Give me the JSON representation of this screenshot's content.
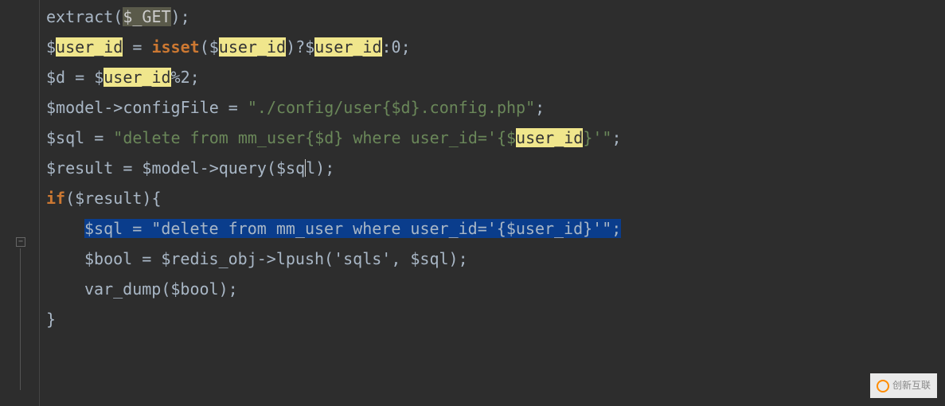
{
  "code": {
    "line1": {
      "t1": "extract(",
      "t2": "$_GET",
      "t3": ");"
    },
    "line2": {
      "t1": "$",
      "t2": "user_id",
      "t3": " = ",
      "t4": "isset",
      "t5": "($",
      "t6": "user_id",
      "t7": ")?$",
      "t8": "user_id",
      "t9": ":0;"
    },
    "line3": {
      "t1": "$d = $",
      "t2": "user_id",
      "t3": "%2;"
    },
    "line4": {
      "t1": "$model->configFile = ",
      "t2": "\"./config/user{$d}.config.php\"",
      "t3": ";"
    },
    "line5": {
      "t1": "$sql = ",
      "t2": "\"delete from mm_user{$d} where user_id='{$",
      "t3": "user_id",
      "t4": "}'\"",
      "t5": ";"
    },
    "line6": {
      "t1": "$result = $model->query($sq",
      "t2": "l);"
    },
    "line7": {
      "t1": "if",
      "t2": "($result){"
    },
    "line8": {
      "t1": "$sql = ",
      "t2": "\"delete from mm_user where user_id='{$user_id}'\"",
      "t3": ";"
    },
    "line9": {
      "t1": "$bool = $redis_obj->lpush('sqls', $sql);"
    },
    "line10": {
      "t1": "var_dump($bool);"
    },
    "line11": {
      "t1": "}"
    }
  },
  "watermark": {
    "text": "创新互联"
  }
}
